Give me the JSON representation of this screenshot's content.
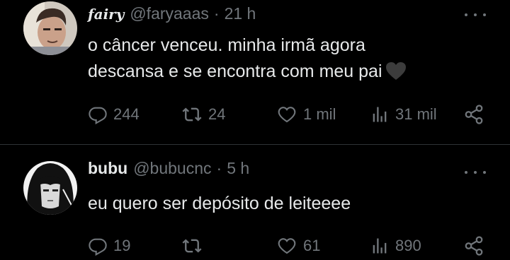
{
  "tweets": [
    {
      "display_name": "fairy",
      "handle": "@faryaaas",
      "separator": "·",
      "time": "21 h",
      "text_line1": "o câncer venceu. minha irmã agora",
      "text_line2": "descansa e se encontra com meu pai",
      "emoji": "black-heart",
      "replies": "244",
      "retweets": "24",
      "likes": "1 mil",
      "views": "31 mil"
    },
    {
      "display_name": "bubu",
      "handle": "@bubucnc",
      "separator": "·",
      "time": "5 h",
      "text_line1": "eu quero ser depósito de leiteeee",
      "replies": "19",
      "retweets": "",
      "likes": "61",
      "views": "890"
    }
  ],
  "colors": {
    "background": "#000000",
    "primary_text": "#e7e9ea",
    "secondary_text": "#71767b",
    "divider": "#2f3336"
  },
  "icons": [
    "reply-icon",
    "retweet-icon",
    "like-icon",
    "views-icon",
    "share-icon",
    "more-icon"
  ]
}
